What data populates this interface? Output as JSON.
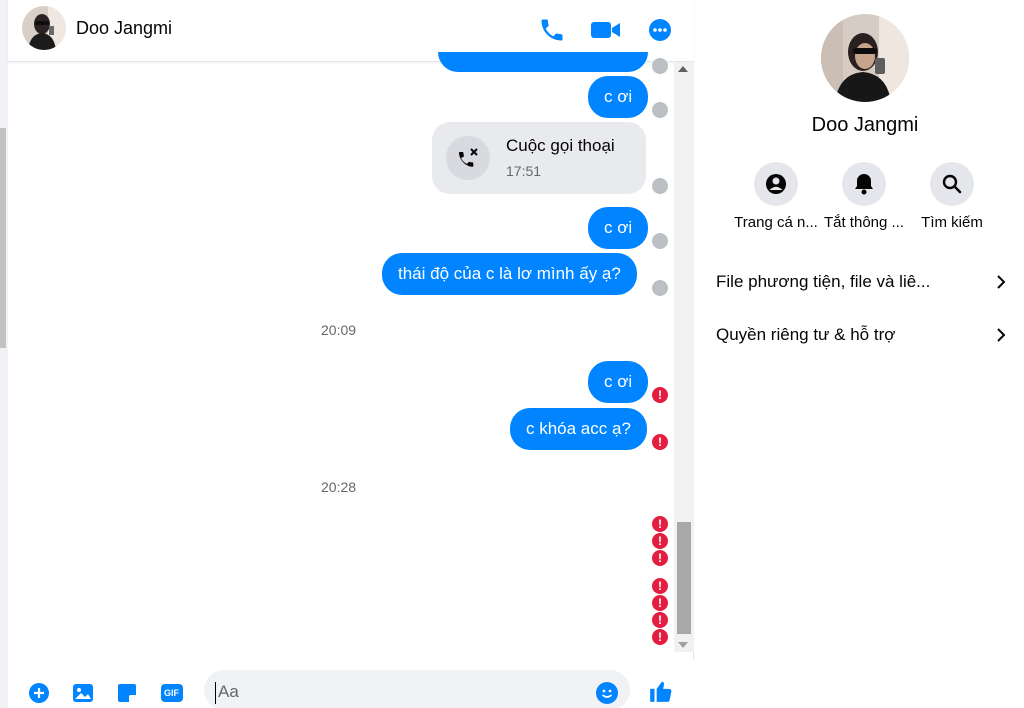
{
  "contact": {
    "name": "Doo Jangmi"
  },
  "header": {
    "icons": [
      "phone-icon",
      "video-camera-icon",
      "more-options-icon"
    ]
  },
  "messages": [
    {
      "type": "outgoing",
      "text": "c ơi",
      "status": "seen"
    },
    {
      "type": "call",
      "title": "Cuộc gọi thoại",
      "time": "17:51",
      "status": "seen"
    },
    {
      "type": "outgoing",
      "text": "c ơi",
      "status": "seen"
    },
    {
      "type": "outgoing",
      "text": "thái độ của c là lơ mình ấy ạ?",
      "status": "seen"
    },
    {
      "type": "time",
      "text": "20:09"
    },
    {
      "type": "outgoing",
      "text": "c ơi",
      "status": "error"
    },
    {
      "type": "outgoing",
      "text": "c khóa acc ạ?",
      "status": "error"
    },
    {
      "type": "time",
      "text": "20:28"
    }
  ],
  "error_markers": "!",
  "composer": {
    "placeholder": "Aa",
    "icons": [
      "add-circle-icon",
      "image-icon",
      "sticker-icon",
      "gif-icon",
      "emoji-icon",
      "thumbs-up-icon"
    ],
    "gif_label": "GIF"
  },
  "info_panel": {
    "name": "Doo Jangmi",
    "actions": [
      {
        "label": "Trang cá n...",
        "icon": "profile-icon"
      },
      {
        "label": "Tắt thông ...",
        "icon": "bell-icon"
      },
      {
        "label": "Tìm kiếm",
        "icon": "search-icon"
      }
    ],
    "sections": [
      {
        "label": "File phương tiện, file và liê..."
      },
      {
        "label": "Quyền riêng tư & hỗ trợ"
      }
    ]
  },
  "colors": {
    "accent": "#0084ff",
    "error": "#e41e3f",
    "seen": "#bcc0c4"
  }
}
